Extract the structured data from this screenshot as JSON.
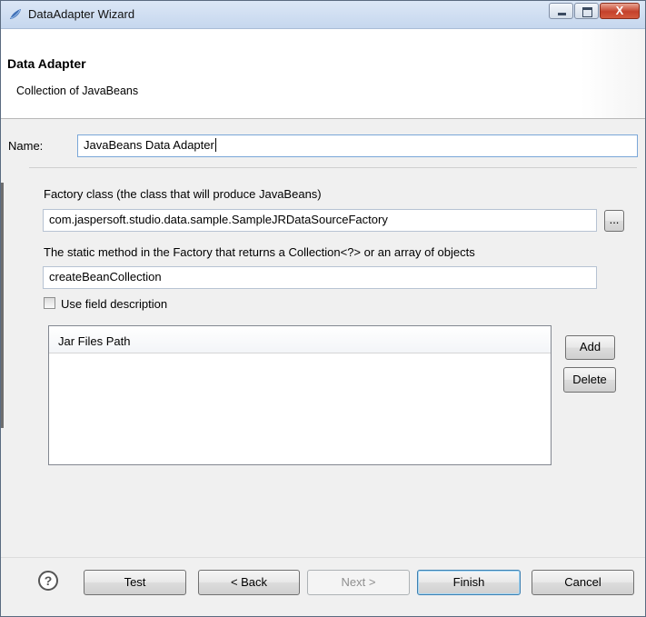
{
  "window": {
    "title": "DataAdapter Wizard",
    "close_glyph": "X"
  },
  "header": {
    "title": "Data Adapter",
    "subtitle": "Collection of JavaBeans"
  },
  "form": {
    "name_label": "Name:",
    "name_value": "JavaBeans Data Adapter",
    "factory_label": "Factory class (the class that will produce JavaBeans)",
    "factory_value": "com.jaspersoft.studio.data.sample.SampleJRDataSourceFactory",
    "browse_label": "...",
    "method_label": "The static method in the Factory that returns a Collection<?> or an array of objects",
    "method_value": "createBeanCollection",
    "use_field_description_label": "Use field description"
  },
  "jar_table": {
    "column_header": "Jar Files Path",
    "add_label": "Add",
    "delete_label": "Delete"
  },
  "footer": {
    "help_glyph": "?",
    "test_label": "Test",
    "back_label": "< Back",
    "next_label": "Next >",
    "finish_label": "Finish",
    "cancel_label": "Cancel"
  },
  "colors": {
    "titlebar": "#c6d7ee",
    "close_button": "#c4412b",
    "default_button_border": "#3c7fb1"
  }
}
